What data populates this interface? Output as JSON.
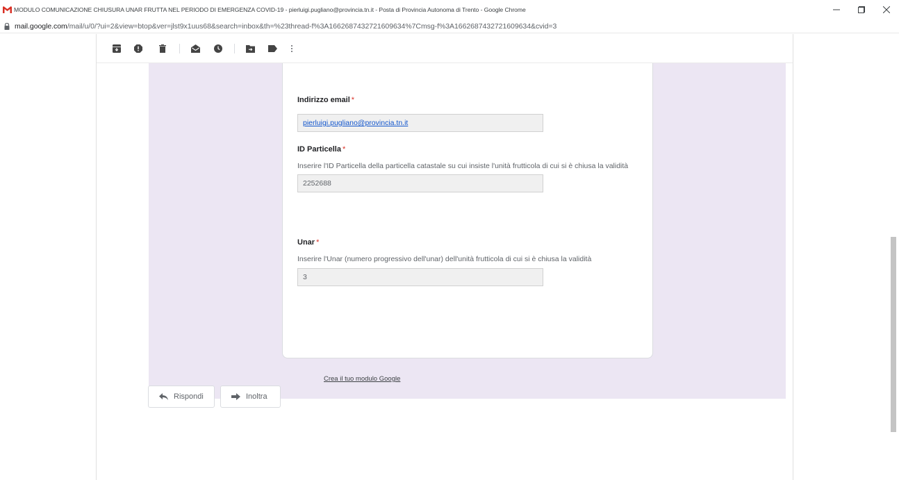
{
  "window": {
    "title": "MODULO COMUNICAZIONE CHIUSURA UNAR FRUTTA NEL PERIODO DI EMERGENZA COVID-19 - pierluigi.pugliano@provincia.tn.it - Posta di Provincia Autonoma di Trento - Google Chrome",
    "url_host": "mail.google.com",
    "url_path": "/mail/u/0/?ui=2&view=btop&ver=jlst9x1uus68&search=inbox&th=%23thread-f%3A1662687432721609634%7Cmsg-f%3A1662687432721609634&cvid=3"
  },
  "toolbar": {
    "icons": [
      "archive-icon",
      "report-spam-icon",
      "delete-icon",
      "mark-unread-icon",
      "snooze-icon",
      "move-to-icon",
      "label-icon",
      "more-icon"
    ]
  },
  "form": {
    "email": {
      "title": "Indirizzo email",
      "required_mark": "*",
      "value": "pierluigi.pugliano@provincia.tn.it"
    },
    "particella": {
      "title": "ID Particella",
      "required_mark": "*",
      "description": "Inserire l'ID Particella della particella catastale su cui insiste l'unità frutticola di cui si è chiusa la validità",
      "value": "2252688"
    },
    "unar": {
      "title": "Unar",
      "required_mark": "*",
      "description": "Inserire l'Unar (numero progressivo dell'unar) dell'unità frutticola di cui si è chiusa la validità",
      "value": "3"
    },
    "create_link": "Crea il tuo modulo Google"
  },
  "actions": {
    "reply_label": "Rispondi",
    "forward_label": "Inoltra"
  },
  "colors": {
    "form_band": "#ece6f3",
    "gmail_red": "#d93025",
    "link": "#1155cc"
  }
}
